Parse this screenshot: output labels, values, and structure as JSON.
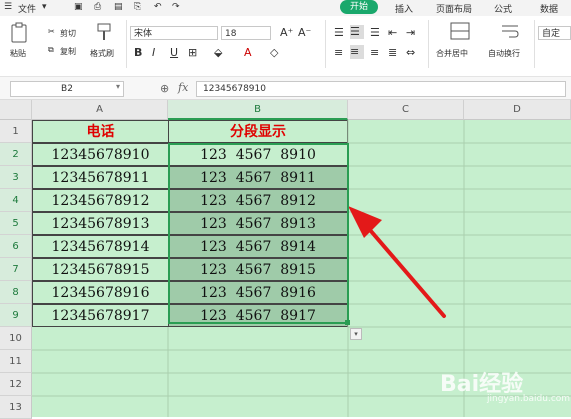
{
  "menubar": {
    "file_label": "文件",
    "tabs": [
      "开始",
      "插入",
      "页面布局",
      "公式",
      "数据"
    ]
  },
  "toolbar": {
    "cut_label": "剪切",
    "copy_label": "复制",
    "paste_label": "粘贴",
    "format_painter_label": "格式刷",
    "font_name": "宋体",
    "font_size": "18",
    "merge_label": "合并居中",
    "wrap_label": "自动换行",
    "custom_label": "自定"
  },
  "formula_bar": {
    "cell_ref": "B2",
    "fx_label": "fx",
    "formula_value": "12345678910"
  },
  "sheet": {
    "columns": [
      "A",
      "B",
      "C",
      "D"
    ],
    "rows": [
      "1",
      "2",
      "3",
      "4",
      "5",
      "6",
      "7",
      "8",
      "9",
      "10",
      "11",
      "12",
      "13"
    ],
    "header_a": "电话",
    "header_b": "分段显示",
    "phones": [
      "12345678910",
      "12345678911",
      "12345678912",
      "12345678913",
      "12345678914",
      "12345678915",
      "12345678916",
      "12345678917"
    ],
    "segmented": [
      "123  4567  8910",
      "123  4567  8911",
      "123  4567  8912",
      "123  4567  8913",
      "123  4567  8914",
      "123  4567  8915",
      "123  4567  8916",
      "123  4567  8917"
    ],
    "selected_column": "B"
  },
  "watermark": {
    "logo_text": "Bai经验",
    "url": "jingyan.baidu.com"
  },
  "colors": {
    "accent": "#1aa86c",
    "sheet_bg": "#c6efce",
    "selection": "#9fcba9",
    "header_text": "#e00000",
    "arrow": "#e31919"
  }
}
